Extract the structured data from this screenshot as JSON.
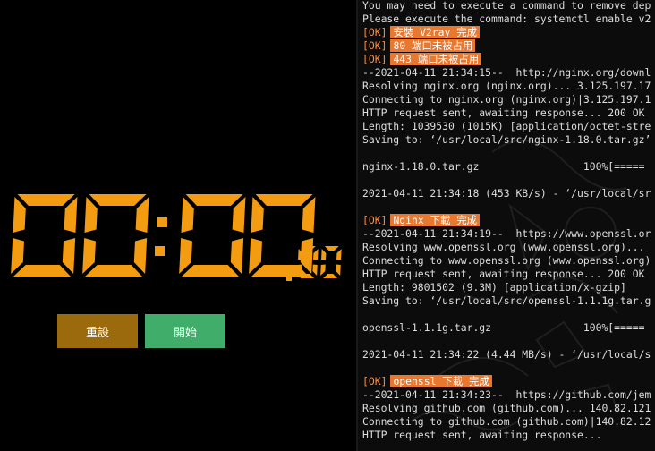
{
  "stopwatch": {
    "minutes": "00",
    "seconds": "00",
    "centiseconds": "00",
    "digit_color": "#f39c12",
    "reset_label": "重設",
    "start_label": "開始",
    "reset_color": "#9a6a0d",
    "start_color": "#41ad6b"
  },
  "terminal": {
    "lines": [
      {
        "text": "You may need to execute a command to remove dep"
      },
      {
        "text": "Please execute the command: systemctl enable v2"
      },
      {
        "tag": "[OK]",
        "highlight": "安裝 V2ray 完成"
      },
      {
        "tag": "[OK]",
        "highlight": "80 端口未被占用"
      },
      {
        "tag": "[OK]",
        "highlight": "443 端口未被占用"
      },
      {
        "text": "--2021-04-11 21:34:15--  http://nginx.org/downl"
      },
      {
        "text": "Resolving nginx.org (nginx.org)... 3.125.197.17"
      },
      {
        "text": "Connecting to nginx.org (nginx.org)|3.125.197.1"
      },
      {
        "text": "HTTP request sent, awaiting response... 200 OK"
      },
      {
        "text": "Length: 1039530 (1015K) [application/octet-stre"
      },
      {
        "text": "Saving to: ‘/usr/local/src/nginx-1.18.0.tar.gz’"
      },
      {
        "text": ""
      },
      {
        "text": "nginx-1.18.0.tar.gz                 100%[====="
      },
      {
        "text": ""
      },
      {
        "text": "2021-04-11 21:34:18 (453 KB/s) - ‘/usr/local/sr"
      },
      {
        "text": ""
      },
      {
        "tag": "[OK]",
        "highlight": "Nginx 下載 完成"
      },
      {
        "text": "--2021-04-11 21:34:19--  https://www.openssl.or"
      },
      {
        "text": "Resolving www.openssl.org (www.openssl.org)... "
      },
      {
        "text": "Connecting to www.openssl.org (www.openssl.org)"
      },
      {
        "text": "HTTP request sent, awaiting response... 200 OK"
      },
      {
        "text": "Length: 9801502 (9.3M) [application/x-gzip]"
      },
      {
        "text": "Saving to: ‘/usr/local/src/openssl-1.1.1g.tar.g"
      },
      {
        "text": ""
      },
      {
        "text": "openssl-1.1.1g.tar.gz               100%[====="
      },
      {
        "text": ""
      },
      {
        "text": "2021-04-11 21:34:22 (4.44 MB/s) - ‘/usr/local/s"
      },
      {
        "text": ""
      },
      {
        "tag": "[OK]",
        "highlight": "openssl 下載 完成"
      },
      {
        "text": "--2021-04-11 21:34:23--  https://github.com/jem"
      },
      {
        "text": "Resolving github.com (github.com)... 140.82.121"
      },
      {
        "text": "Connecting to github.com (github.com)|140.82.12"
      },
      {
        "text": "HTTP request sent, awaiting response..."
      }
    ],
    "ok_color": "#ff8c3a",
    "highlight_color": "#e8782f"
  }
}
